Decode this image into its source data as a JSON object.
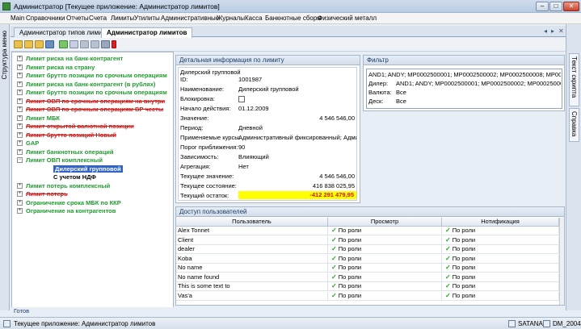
{
  "window": {
    "title": "Администратор [Текущее приложение: Администратор лимитов]",
    "minimize": "–",
    "maximize": "□",
    "close": "✕"
  },
  "menu": [
    "Main",
    "Справочники",
    "Отчеты",
    "Счета",
    "Лимиты",
    "Утилиты",
    "Административные",
    "Журналы",
    "Касса",
    "Банкнотные сборы",
    "Физический металл"
  ],
  "left_tab": "Структура меню",
  "right_tabs": [
    "Текст скрипта",
    "Справка"
  ],
  "doc_tabs": [
    "Администратор типов лимитов",
    "Администратор лимитов"
  ],
  "doc_tab_controls": [
    "◂",
    "▸",
    "✕"
  ],
  "tree": [
    {
      "text": "Лимит риска на банк-контрагент",
      "style": "green",
      "level": 0,
      "expander": "+"
    },
    {
      "text": "Лимит риска на страну",
      "style": "green",
      "level": 0,
      "expander": "+"
    },
    {
      "text": "Лимит брутто позиции по срочным операциям",
      "style": "green",
      "level": 0,
      "expander": "+"
    },
    {
      "text": "Лимит риска на банк-контрагент (в рублях)",
      "style": "green",
      "level": 0,
      "expander": "+"
    },
    {
      "text": "Лимит брутто позиции по срочным операциям",
      "style": "green",
      "level": 0,
      "expander": "+"
    },
    {
      "text": "Лимит ОВП по срочным операциям на внутри",
      "style": "red",
      "level": 0,
      "expander": "+"
    },
    {
      "text": "Лимит ОВП по срочным операциям ВР честы",
      "style": "red",
      "level": 0,
      "expander": "+"
    },
    {
      "text": "Лимит МБК",
      "style": "green",
      "level": 0,
      "expander": "+"
    },
    {
      "text": "Лимит открытой валютной позиции",
      "style": "red",
      "level": 0,
      "expander": "+"
    },
    {
      "text": "Лимит брутто позиций Новый",
      "style": "red",
      "level": 0,
      "expander": "+"
    },
    {
      "text": "GAP",
      "style": "green",
      "level": 0,
      "expander": "+"
    },
    {
      "text": "Лимит банкнотных операций",
      "style": "green",
      "level": 0,
      "expander": "+"
    },
    {
      "text": "Лимит ОВП комплексный",
      "style": "green",
      "level": 0,
      "expander": "−"
    },
    {
      "text": "Дилерский групповой",
      "style": "selected",
      "level": 1,
      "expander": ""
    },
    {
      "text": "С учетом НДФ",
      "style": "black",
      "level": 1,
      "expander": ""
    },
    {
      "text": "Лимит потерь комплексный",
      "style": "green",
      "level": 0,
      "expander": "+"
    },
    {
      "text": "Лимит потерь",
      "style": "red",
      "level": 0,
      "expander": "+"
    },
    {
      "text": "Ограничение срока МБК по ККР",
      "style": "green",
      "level": 0,
      "expander": "+"
    },
    {
      "text": "Ограничение на контрагентов",
      "style": "green",
      "level": 0,
      "expander": "+"
    }
  ],
  "details": {
    "header": "Детальная информация по лимиту",
    "name_line": "Дилерский групповой",
    "id_label": "ID:",
    "id_value": "1001987",
    "rows": [
      {
        "label": "Наименование:",
        "value": "Дилерский групповой",
        "align": "left"
      },
      {
        "label": "Блокировка:",
        "value": "",
        "align": "checkbox"
      },
      {
        "label": "Начало действия:",
        "value": "01.12.2009",
        "align": "left"
      },
      {
        "label": "Значение:",
        "value": "4 546 546,00",
        "align": "right"
      },
      {
        "label": "Период:",
        "value": "Дневной",
        "align": "left"
      },
      {
        "label": "Применяемые курсы:",
        "value": "Административный фиксированный; Адми...",
        "align": "left"
      },
      {
        "label": "Порог приближения:",
        "value": "90",
        "align": "left"
      },
      {
        "label": "Зависимость:",
        "value": "Влияющий",
        "align": "left"
      },
      {
        "label": "Агрегация:",
        "value": "Нет",
        "align": "left"
      },
      {
        "label": "Текущее значение:",
        "value": "4 546 546,00",
        "align": "right"
      },
      {
        "label": "Текущее состояние:",
        "value": "416 838 025,95",
        "align": "right"
      },
      {
        "label": "Текущий остаток:",
        "value": "-412 291 479,95",
        "align": "highlight"
      }
    ],
    "highlight_color": "#ffff00",
    "negative_color": "#d01b1b"
  },
  "filter": {
    "header": "Фильтр",
    "summary": "AND1; ANDY; MP0002500001; MP0002500002; MP0002500008; MP00025...",
    "rows": [
      {
        "label": "Дилер:",
        "value": "AND1; ANDY; MP0002500001; MP0002500002; MP0002500008; MP00025..."
      },
      {
        "label": "Валюта:",
        "value": "Все"
      },
      {
        "label": "Деск:",
        "value": "Все"
      }
    ]
  },
  "access": {
    "header": "Доступ пользователей",
    "columns": [
      "Пользователь",
      "Просмотр",
      "Нотификация"
    ],
    "rows": [
      [
        "Alex Tonnet",
        "По роли",
        "По роли"
      ],
      [
        "Client",
        "По роли",
        "По роли"
      ],
      [
        "dealer",
        "По роли",
        "По роли"
      ],
      [
        "Koba",
        "По роли",
        "По роли"
      ],
      [
        "No name",
        "По роли",
        "По роли"
      ],
      [
        "No name found",
        "По роли",
        "По роли"
      ],
      [
        "This is some text to",
        "По роли",
        "По роли"
      ],
      [
        "Vas'a",
        "По роли",
        "По роли"
      ]
    ],
    "tick": "✓"
  },
  "status_line": "Готов",
  "statusbar": {
    "text": "Текущее приложение: Администратор лимитов",
    "server": "SATANA",
    "db": "DM_2004"
  }
}
